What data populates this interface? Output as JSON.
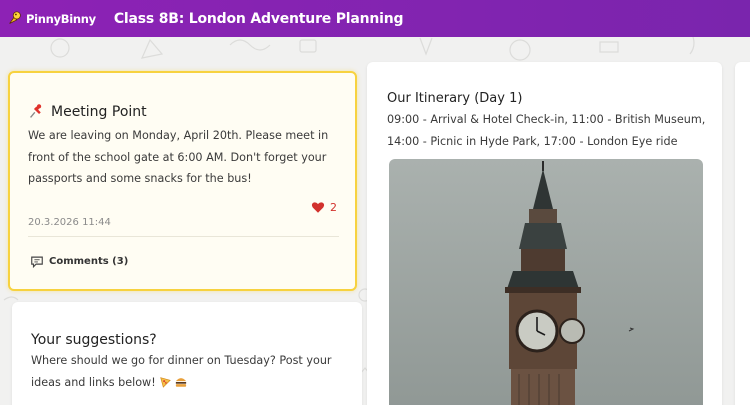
{
  "header": {
    "logo_text": "PinnyBinny",
    "board_title": "Class 8B: London Adventure Planning",
    "bar_color": "#8d22b5"
  },
  "posts": {
    "meeting": {
      "icon": "pushpin-icon",
      "title": "Meeting Point",
      "body": "We are leaving on Monday, April 20th. Please meet in front of the school gate at 6:00 AM. Don't forget your passports and some snacks for the bus!",
      "date": "20.3.2026 11:44",
      "likes": "2",
      "comments_label": "Comments (3)",
      "highlight_color": "#f7d23f"
    },
    "suggestions": {
      "title": "Your suggestions?",
      "body": "Where should we go for dinner on Tuesday? Post your ideas and links below!",
      "emojis": [
        "pizza-icon",
        "burger-icon"
      ]
    },
    "itinerary": {
      "title": "Our Itinerary (Day 1)",
      "body": "09:00 - Arrival & Hotel Check-in, 11:00 - British Museum, 14:00 - Picnic in Hyde Park, 17:00 - London Eye ride",
      "image": "big-ben-photo"
    }
  }
}
